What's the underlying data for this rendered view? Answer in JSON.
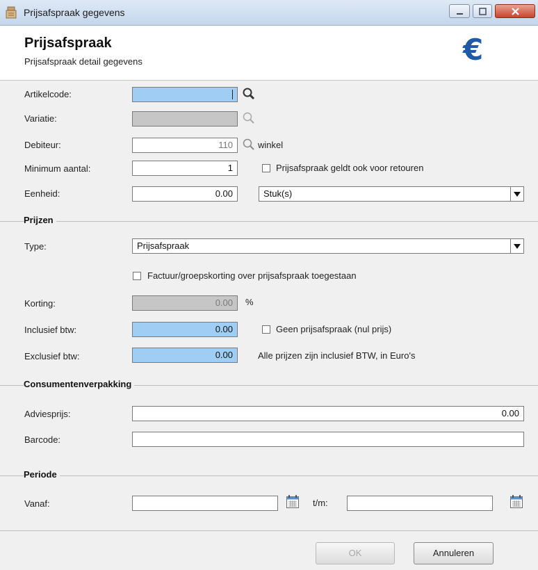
{
  "window": {
    "title": "Prijsafspraak gegevens"
  },
  "header": {
    "title": "Prijsafspraak",
    "subtitle": "Prijsafspraak detail gegevens",
    "logo_symbol": "€",
    "logo_color": "#1e5aa8"
  },
  "form": {
    "artikelcode": {
      "label": "Artikelcode:",
      "value": ""
    },
    "variatie": {
      "label": "Variatie:",
      "value": ""
    },
    "debiteur": {
      "label": "Debiteur:",
      "value": "110",
      "name": "winkel"
    },
    "minimum_aantal": {
      "label": "Minimum aantal:",
      "value": "1"
    },
    "retouren_checkbox": {
      "label": "Prijsafspraak geldt ook voor retouren",
      "checked": false
    },
    "eenheid": {
      "label": "Eenheid:",
      "value": "0.00",
      "unit": "Stuk(s)"
    }
  },
  "prijzen": {
    "section_title": "Prijzen",
    "type": {
      "label": "Type:",
      "value": "Prijsafspraak"
    },
    "factuur_checkbox": {
      "label": "Factuur/groepskorting over prijsafspraak toegestaan",
      "checked": false
    },
    "korting": {
      "label": "Korting:",
      "value": "0.00",
      "unit": "%"
    },
    "inclusief": {
      "label": "Inclusief btw:",
      "value": "0.00"
    },
    "geen_checkbox": {
      "label": "Geen prijsafspraak (nul prijs)",
      "checked": false
    },
    "exclusief": {
      "label": "Exclusief btw:",
      "value": "0.00"
    },
    "note": "Alle prijzen zijn inclusief BTW, in Euro's"
  },
  "consumentenverpakking": {
    "section_title": "Consumentenverpakking",
    "adviesprijs": {
      "label": "Adviesprijs:",
      "value": "0.00"
    },
    "barcode": {
      "label": "Barcode:",
      "value": ""
    }
  },
  "periode": {
    "section_title": "Periode",
    "vanaf": {
      "label": "Vanaf:",
      "value": ""
    },
    "tm": {
      "label": "t/m:",
      "value": ""
    }
  },
  "buttons": {
    "ok": "OK",
    "cancel": "Annuleren"
  },
  "colors": {
    "input_highlight": "#9fcdf3",
    "input_disabled": "#c6c6c6",
    "background": "#f0f0f0"
  }
}
